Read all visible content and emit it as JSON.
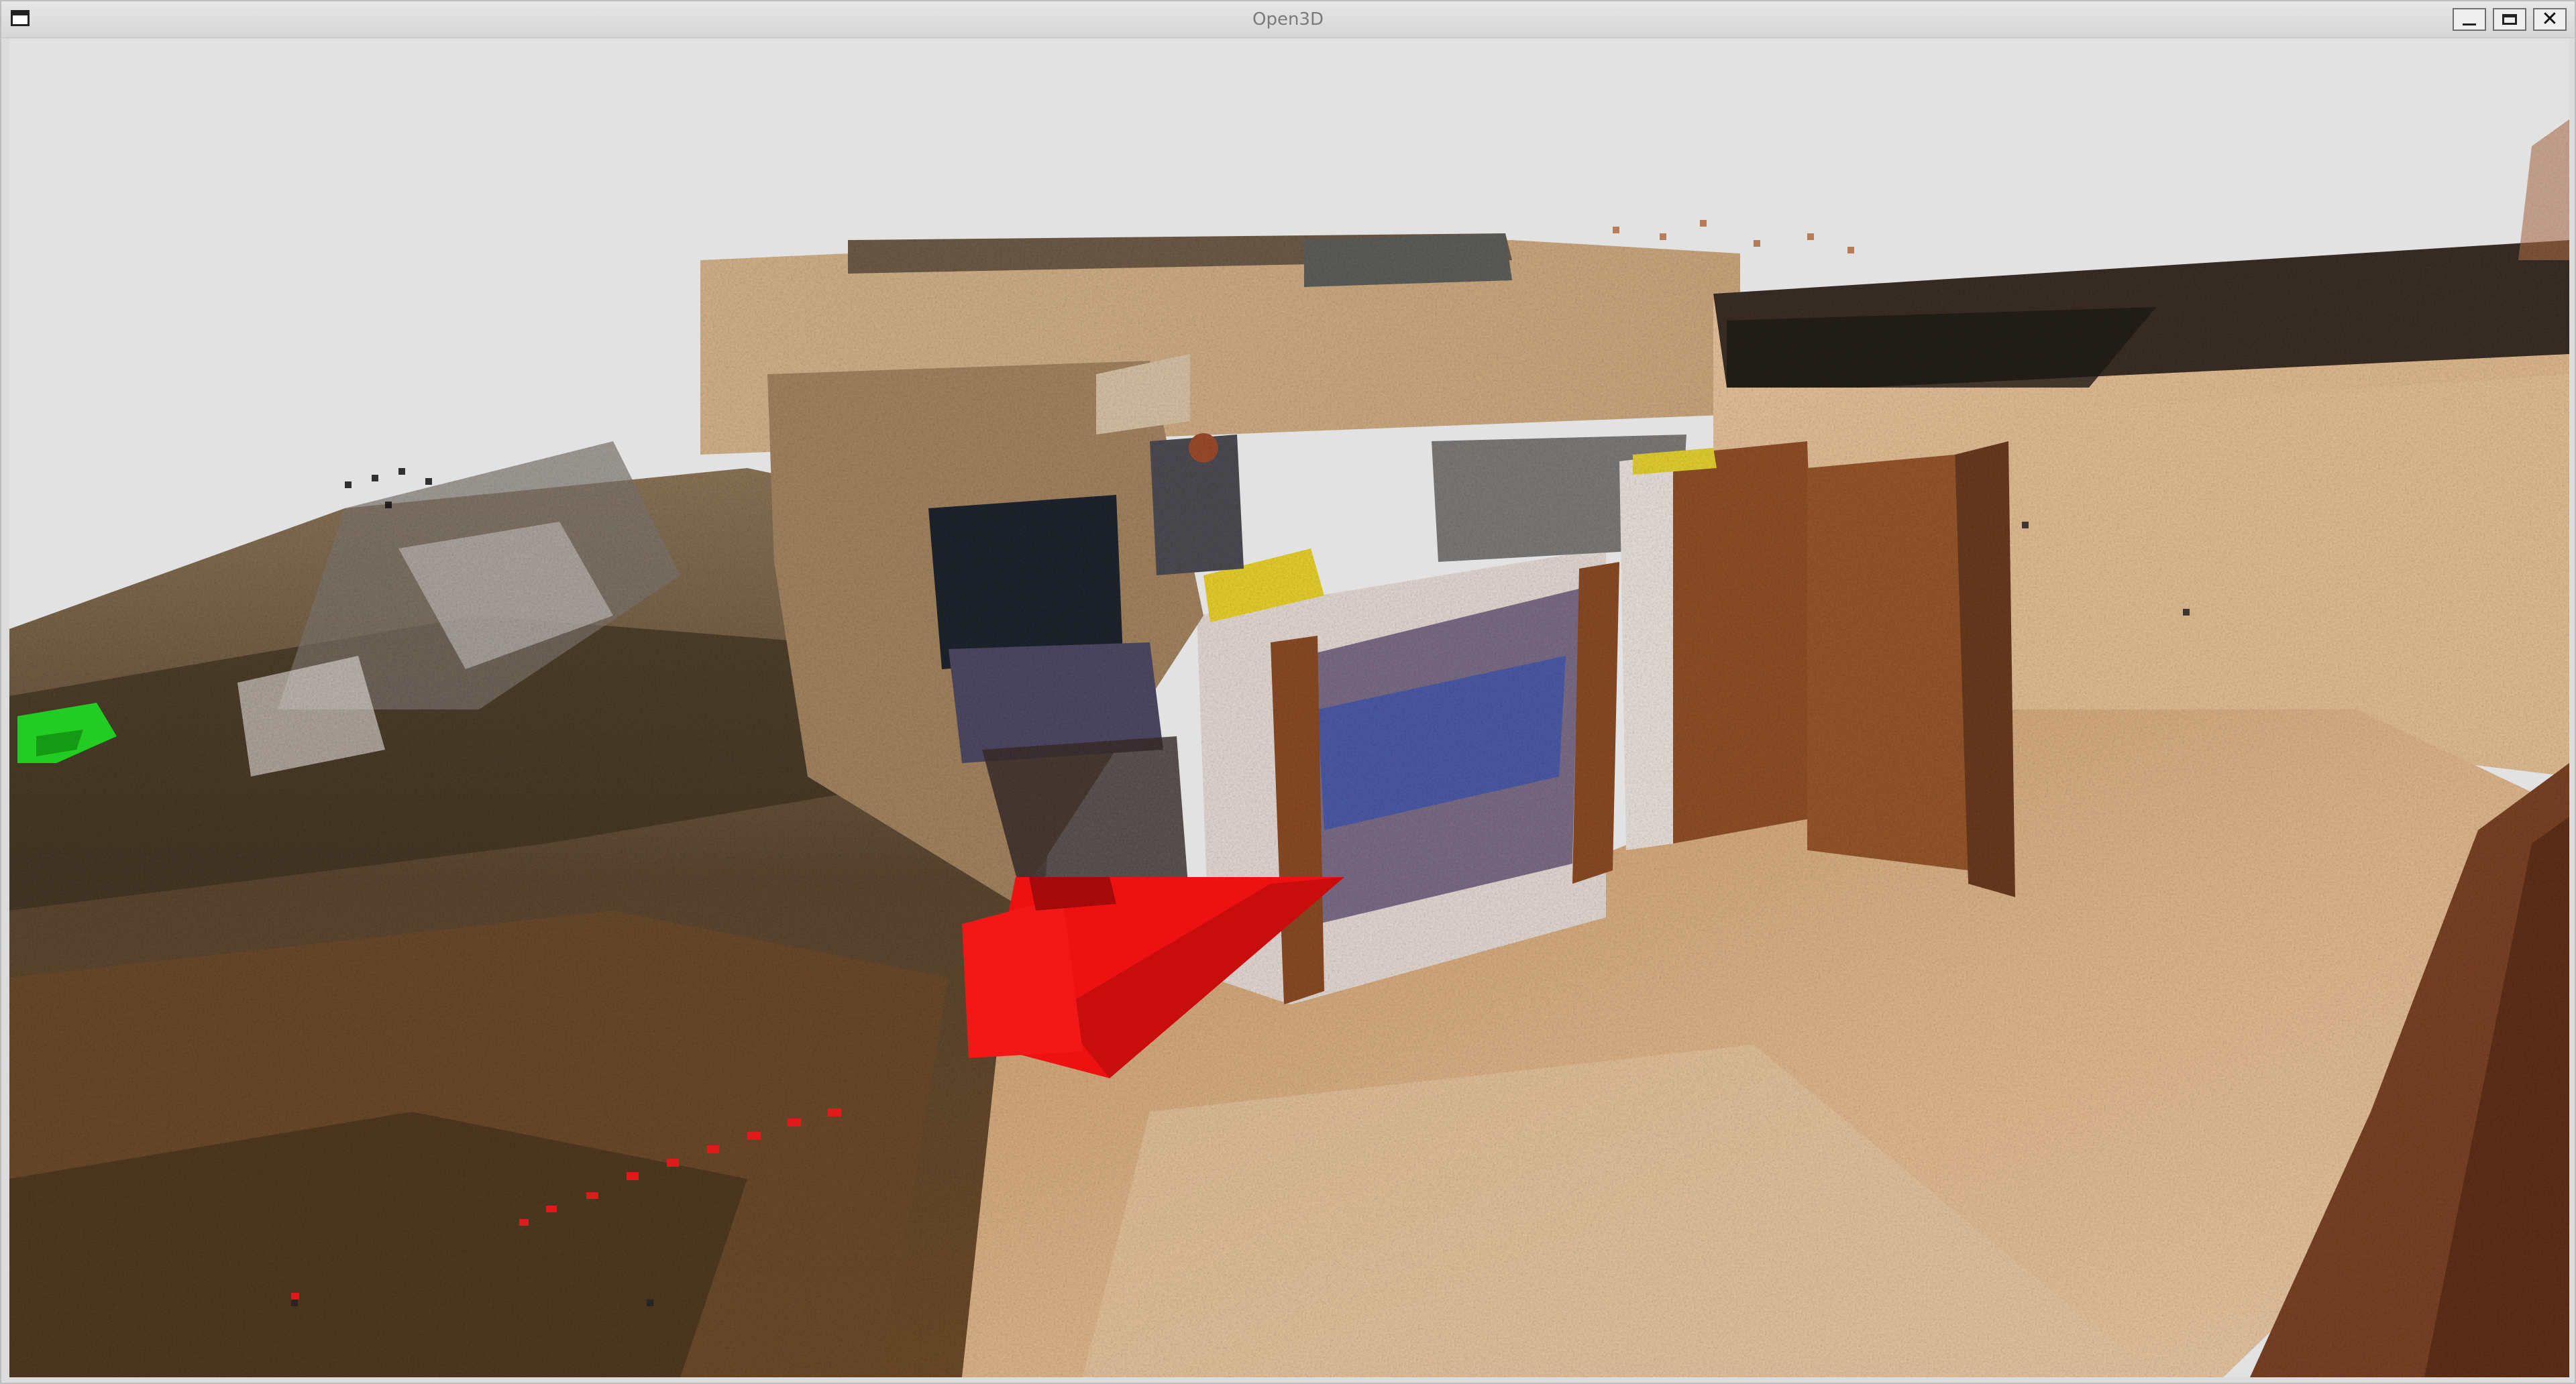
{
  "window": {
    "title": "Open3D"
  },
  "icons": {
    "menu": "window-menu-icon",
    "minimize": "minimize-icon",
    "maximize": "maximize-icon",
    "close": "close-icon"
  },
  "glyphs": {
    "close": "✕"
  },
  "colors": {
    "background": "#e2e2e2",
    "camera_frustum": "#ee1111",
    "accent_green": "#22cc22",
    "accent_yellow": "#e8d021"
  }
}
